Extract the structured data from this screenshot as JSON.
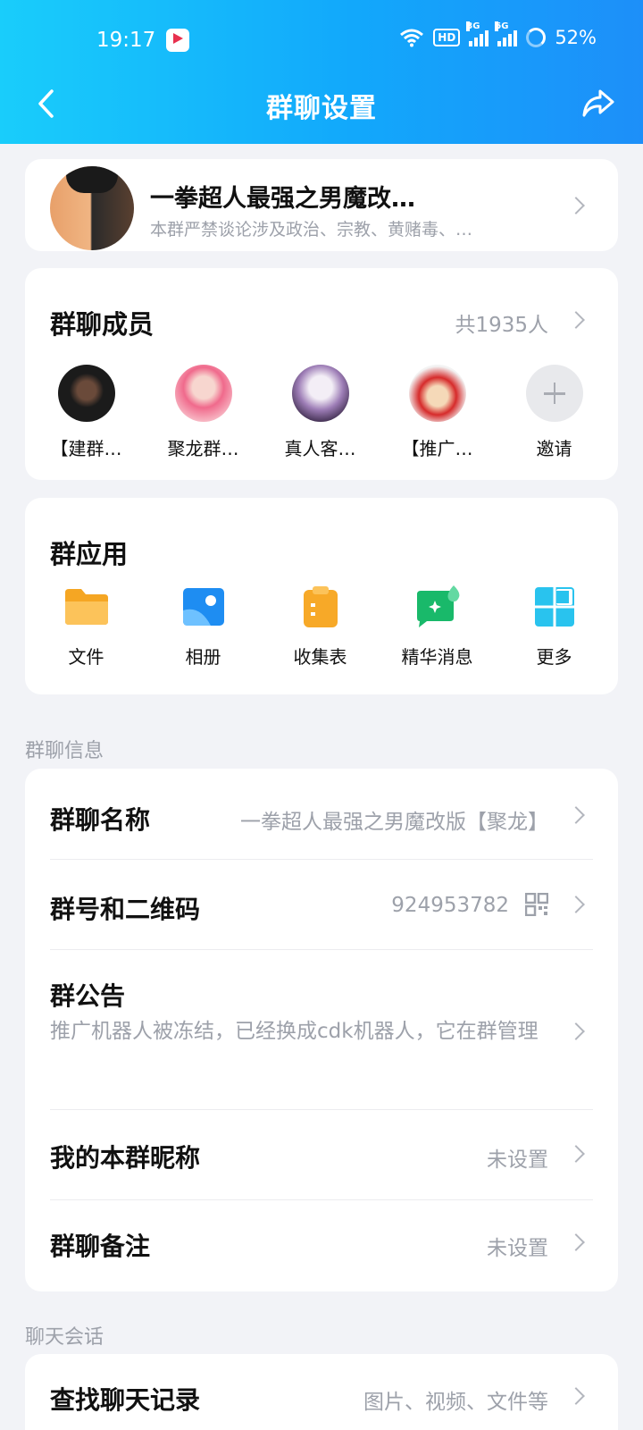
{
  "status_bar": {
    "time": "19:17",
    "app_icon": "youku-icon",
    "hd_label": "HD",
    "net1": "3G",
    "net2": "5G",
    "battery": "52%"
  },
  "nav": {
    "title": "群聊设置",
    "back_icon": "back-arrow-icon",
    "share_icon": "share-icon"
  },
  "group": {
    "name": "一拳超人最强之男魔改…",
    "description": "本群严禁谈论涉及政治、宗教、黄赌毒、…"
  },
  "members": {
    "title": "群聊成员",
    "count": "共1935人",
    "list": [
      {
        "name": "【建群…"
      },
      {
        "name": "聚龙群…"
      },
      {
        "name": "真人客…"
      },
      {
        "name": "【推广…"
      }
    ],
    "invite_label": "邀请"
  },
  "apps": {
    "title": "群应用",
    "items": [
      {
        "label": "文件",
        "icon": "folder-icon"
      },
      {
        "label": "相册",
        "icon": "album-icon"
      },
      {
        "label": "收集表",
        "icon": "clipboard-icon"
      },
      {
        "label": "精华消息",
        "icon": "highlight-message-icon"
      },
      {
        "label": "更多",
        "icon": "grid-icon"
      }
    ]
  },
  "info": {
    "section_label": "群聊信息",
    "name_row": {
      "title": "群聊名称",
      "value": "一拳超人最强之男魔改版【聚龙】"
    },
    "id_row": {
      "title": "群号和二维码",
      "value": "924953782"
    },
    "notice_row": {
      "title": "群公告",
      "value": "推广机器人被冻结，已经换成cdk机器人，它在群管理"
    },
    "nickname_row": {
      "title": "我的本群昵称",
      "value": "未设置"
    },
    "remark_row": {
      "title": "群聊备注",
      "value": "未设置"
    }
  },
  "chat": {
    "section_label": "聊天会话",
    "search_row": {
      "title": "查找聊天记录",
      "value": "图片、视频、文件等"
    }
  },
  "colors": {
    "header_start": "#19cdfb",
    "header_end": "#1d8ff9",
    "background": "#f2f3f7",
    "secondary_text": "#9da1aa"
  }
}
